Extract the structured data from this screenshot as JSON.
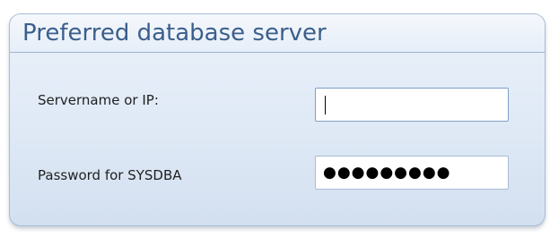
{
  "panel": {
    "title": "Preferred database server"
  },
  "fields": [
    {
      "label": "Servername or IP:",
      "value": ""
    },
    {
      "label": "Password for SYSDBA",
      "value_masked": "●●●●●●●●●"
    }
  ]
}
